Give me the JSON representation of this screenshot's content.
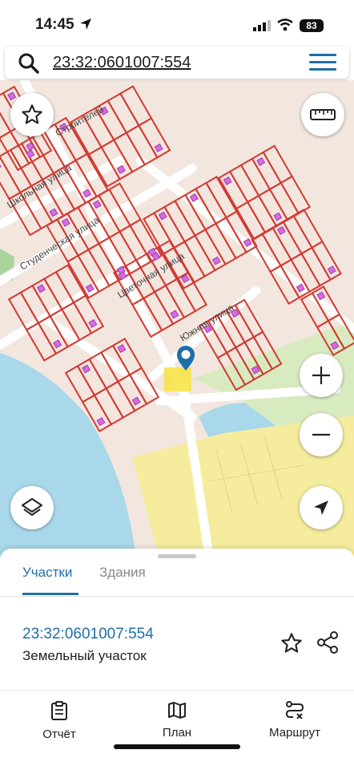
{
  "status_bar": {
    "time": "14:45",
    "battery": "83"
  },
  "search": {
    "query": "23:32:0601007:554"
  },
  "map": {
    "streets": [
      "Строителей",
      "Школьная улица",
      "Студенческая улица",
      "Цветочная улица",
      "Южная улица"
    ],
    "buttons": [
      "favorite-star",
      "ruler",
      "zoom-in",
      "zoom-out",
      "layers",
      "locate-me"
    ]
  },
  "panel": {
    "tabs": [
      "Участки",
      "Здания"
    ],
    "active_tab": "Участки",
    "parcel_number": "23:32:0601007:554",
    "parcel_type": "Земельный участок"
  },
  "bottom_nav": {
    "report": "Отчёт",
    "plan": "План",
    "route": "Маршрут"
  },
  "colors": {
    "accent": "#1e6fa8",
    "parcel_outline": "#d23a32",
    "water": "#a8d8ea",
    "field": "#f5ec9e"
  }
}
